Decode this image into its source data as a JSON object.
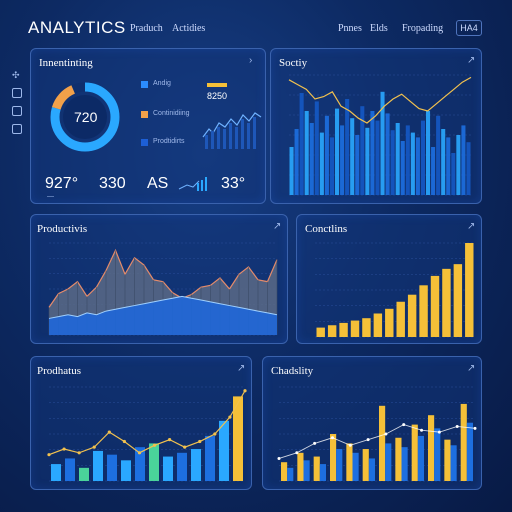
{
  "header": {
    "brand": "ANALYTICS",
    "nav": [
      "Praduch",
      "Actidies"
    ],
    "right_nav": [
      "Pnnes",
      "Elds",
      "Fropading"
    ],
    "badge": "HA4"
  },
  "panel_top_left": {
    "title": "Innentinting",
    "donut_value": "720",
    "legend": [
      {
        "label": "Andig",
        "color": "#2b8cff"
      },
      {
        "label": "Continidiing",
        "color": "#f2a14a"
      },
      {
        "label": "Prodtidirts",
        "color": "#1d5fd6"
      }
    ],
    "top_value": "8250",
    "stats": [
      "927°",
      "330",
      "AS",
      "33°"
    ],
    "colors": {
      "donut_ring": "#2aa8ff",
      "donut_accent": "#f2a14a",
      "bar_yellow": "#f5c038"
    }
  },
  "panel_top_right": {
    "title": "Soctiy",
    "chart_data": {
      "type": "bar",
      "values": [
        40,
        55,
        85,
        70,
        60,
        78,
        52,
        66,
        48,
        72,
        58,
        80,
        64,
        50,
        74,
        56,
        70,
        62,
        86,
        68,
        54,
        60,
        45,
        58,
        52,
        48,
        62,
        70,
        40,
        66,
        55,
        48,
        35,
        50,
        58,
        44
      ],
      "line": [
        96,
        92,
        88,
        80,
        82,
        86,
        74,
        70,
        64,
        60,
        66,
        74,
        80,
        84,
        78,
        72,
        70,
        76,
        82,
        88,
        94,
        98
      ]
    }
  },
  "panel_mid_left": {
    "title": "Productivis",
    "chart_data": {
      "type": "area",
      "series": [
        {
          "values": [
            30,
            45,
            50,
            58,
            42,
            52,
            70,
            92,
            66,
            84,
            76,
            60,
            58,
            46,
            40,
            44,
            52,
            54,
            62,
            50,
            66,
            74,
            60,
            58,
            82
          ]
        },
        {
          "values": [
            18,
            20,
            22,
            20,
            24,
            22,
            26,
            28,
            30,
            32,
            34,
            36,
            38,
            40,
            42,
            40,
            38,
            36,
            34,
            32,
            30,
            28,
            26,
            24,
            22
          ]
        }
      ]
    }
  },
  "panel_mid_right": {
    "title": "Conctlins",
    "chart_data": {
      "type": "bar",
      "values": [
        8,
        10,
        12,
        14,
        16,
        20,
        24,
        30,
        36,
        44,
        52,
        58,
        62,
        80
      ]
    }
  },
  "panel_bot_left": {
    "title": "Prodhatus",
    "chart_data": {
      "type": "bar",
      "values": [
        18,
        24,
        14,
        32,
        28,
        22,
        36,
        40,
        26,
        30,
        34,
        48,
        64,
        90
      ],
      "line": [
        28,
        34,
        30,
        36,
        52,
        42,
        30,
        38,
        44,
        36,
        42,
        50,
        68,
        96
      ]
    }
  },
  "panel_bot_right": {
    "title": "Chadslity",
    "chart_data": {
      "type": "bar",
      "series": [
        {
          "name": "",
          "values": [
            20,
            30,
            26,
            50,
            40,
            34,
            80,
            46,
            60,
            70,
            44,
            82
          ]
        },
        {
          "name": "",
          "values": [
            14,
            22,
            18,
            34,
            30,
            24,
            40,
            36,
            48,
            56,
            38,
            62
          ]
        }
      ],
      "line": [
        24,
        30,
        40,
        46,
        38,
        44,
        50,
        60,
        54,
        52,
        58,
        56
      ]
    }
  }
}
